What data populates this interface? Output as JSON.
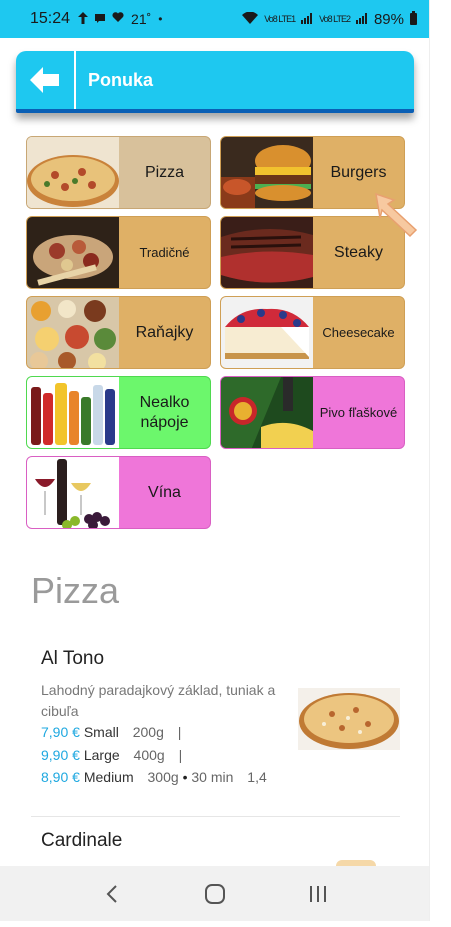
{
  "status_bar": {
    "time": "15:24",
    "temperature": "21˚",
    "network": "Vo8 LTE1",
    "network2": "Vo8 LTE2",
    "battery": "89%"
  },
  "header": {
    "title": "Ponuka"
  },
  "categories": [
    {
      "label": "Pizza",
      "bg": "#d8c19b",
      "border": "#c8a775"
    },
    {
      "label": "Burgers",
      "bg": "#dfb066",
      "border": "#cf9f55"
    },
    {
      "label": "Tradičné",
      "bg": "#dfb066",
      "border": "#cf9f55"
    },
    {
      "label": "Steaky",
      "bg": "#dfb066",
      "border": "#cf9f55"
    },
    {
      "label": "Raňajky",
      "bg": "#dfb066",
      "border": "#cf9f55"
    },
    {
      "label": "Cheesecake",
      "bg": "#dfb066",
      "border": "#cf9f55"
    },
    {
      "label": "Nealko nápoje",
      "bg": "#6cf76c",
      "border": "#4fd94f"
    },
    {
      "label": "Pivo fľaškové",
      "bg": "#ef76d9",
      "border": "#d95fc3"
    },
    {
      "label": "Vína",
      "bg": "#ef76d9",
      "border": "#d95fc3"
    }
  ],
  "menu": {
    "section_title": "Pizza",
    "items": [
      {
        "name": "Al Tono",
        "description": "Lahodný paradajkový základ, tuniak a cibuľa",
        "prices": [
          {
            "amount": "7,90",
            "currency": "€",
            "size": "Small",
            "weight": "200g",
            "suffix": "|"
          },
          {
            "amount": "9,90",
            "currency": "€",
            "size": "Large",
            "weight": "400g",
            "suffix": "|"
          },
          {
            "amount": "8,90",
            "currency": "€",
            "size": "Medium",
            "weight": "300g",
            "time": "30 min",
            "allergens": "1,4"
          }
        ]
      },
      {
        "name": "Cardinale"
      }
    ]
  },
  "colors": {
    "accent": "#1ec8f0",
    "header_underline": "#0a5fb5",
    "price": "#1ea8e0"
  }
}
